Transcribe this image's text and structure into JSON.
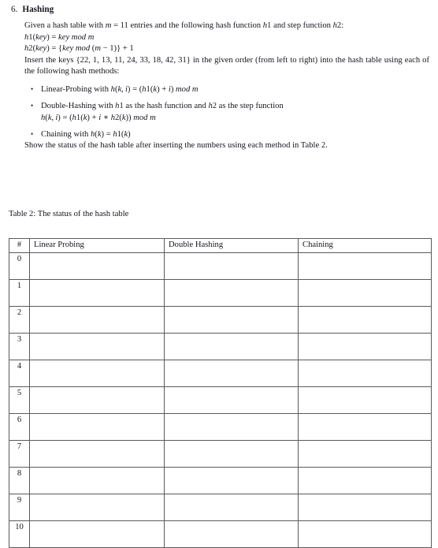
{
  "problem": {
    "number": "6.",
    "title": "Hashing",
    "intro_line1": "Given a hash table with m = 11 entries and the following hash function h1 and step",
    "intro_line2": "function h2:",
    "intro_text": "Given a hash table with m = 11 entries and the following hash function h1 and step function h2:",
    "formula_h1": "h1(key) = key mod m",
    "formula_h2": "h2(key) = {key mod (m − 1)} + 1",
    "insert_text": "Insert the keys {22, 1, 13, 11, 24, 33, 18, 42, 31} in the given order (from left to right) into the hash table using each of the following hash methods:",
    "keys": [
      22,
      1,
      13,
      11,
      24,
      33,
      18,
      42,
      31
    ],
    "m": 11,
    "methods": [
      {
        "name": "Linear-Probing",
        "text": "Linear-Probing with h(k, i) = (h1(k) + i) mod m",
        "formula": "h(k, i) = (h1(k) + i) mod m"
      },
      {
        "name": "Double-Hashing",
        "text": "Double-Hashing with h1 as the hash function and h2 as the step function",
        "formula": "h(k, i) = (h1(k) + i * h2(k)) mod m"
      },
      {
        "name": "Chaining",
        "text": "Chaining with h(k) = h1(k)",
        "formula": "h(k) = h1(k)"
      }
    ],
    "show_text": "Show the status of the hash table after inserting the numbers using each method in Table 2."
  },
  "table": {
    "caption": "Table 2: The status of the hash table",
    "columns": [
      "#",
      "Linear Probing",
      "Double Hashing",
      "Chaining"
    ],
    "rows": [
      {
        "index": "0",
        "linear_probing": "",
        "double_hashing": "",
        "chaining": ""
      },
      {
        "index": "1",
        "linear_probing": "",
        "double_hashing": "",
        "chaining": ""
      },
      {
        "index": "2",
        "linear_probing": "",
        "double_hashing": "",
        "chaining": ""
      },
      {
        "index": "3",
        "linear_probing": "",
        "double_hashing": "",
        "chaining": ""
      },
      {
        "index": "4",
        "linear_probing": "",
        "double_hashing": "",
        "chaining": ""
      },
      {
        "index": "5",
        "linear_probing": "",
        "double_hashing": "",
        "chaining": ""
      },
      {
        "index": "6",
        "linear_probing": "",
        "double_hashing": "",
        "chaining": ""
      },
      {
        "index": "7",
        "linear_probing": "",
        "double_hashing": "",
        "chaining": ""
      },
      {
        "index": "8",
        "linear_probing": "",
        "double_hashing": "",
        "chaining": ""
      },
      {
        "index": "9",
        "linear_probing": "",
        "double_hashing": "",
        "chaining": ""
      },
      {
        "index": "10",
        "linear_probing": "",
        "double_hashing": "",
        "chaining": ""
      }
    ]
  },
  "colors": {
    "text": "#16161d",
    "rule": "#5a5a5a",
    "page": "#ffffff"
  }
}
